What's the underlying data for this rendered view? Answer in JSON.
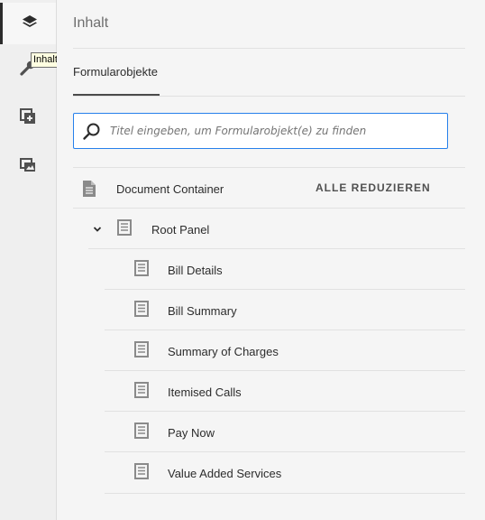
{
  "rail": {
    "items": [
      {
        "name": "layers-icon",
        "active": true
      },
      {
        "name": "wrench-icon",
        "active": false
      },
      {
        "name": "add-fragment-icon",
        "active": false
      },
      {
        "name": "media-icon",
        "active": false
      }
    ],
    "tooltip": "Inhalt"
  },
  "panel": {
    "title": "Inhalt",
    "tab_label": "Formularobjekte",
    "search_placeholder": "Titel eingeben, um Formularobjekt(e) zu finden",
    "collapse_all_label": "ALLE REDUZIEREN"
  },
  "tree": {
    "root": {
      "label": "Document Container",
      "icon": "document-icon"
    },
    "panel": {
      "label": "Root Panel",
      "icon": "panel-icon",
      "expanded": true
    },
    "children": [
      {
        "label": "Bill Details"
      },
      {
        "label": "Bill Summary"
      },
      {
        "label": "Summary of Charges"
      },
      {
        "label": "Itemised Calls"
      },
      {
        "label": "Pay Now"
      },
      {
        "label": "Value Added Services"
      }
    ]
  }
}
